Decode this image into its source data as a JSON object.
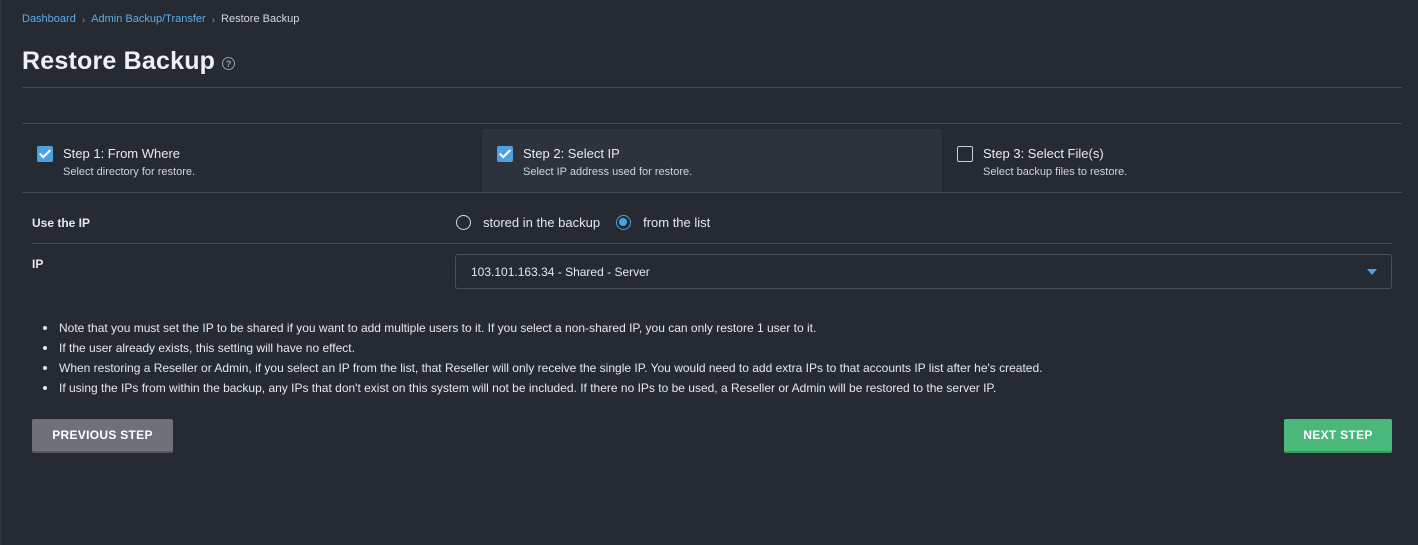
{
  "breadcrumb": {
    "items": [
      "Dashboard",
      "Admin Backup/Transfer"
    ],
    "current": "Restore Backup"
  },
  "page": {
    "title": "Restore Backup",
    "help_icon": "question-circle-icon"
  },
  "steps": [
    {
      "title": "Step 1: From Where",
      "subtitle": "Select directory for restore.",
      "checked": true,
      "active": false
    },
    {
      "title": "Step 2: Select IP",
      "subtitle": "Select IP address used for restore.",
      "checked": true,
      "active": true
    },
    {
      "title": "Step 3: Select File(s)",
      "subtitle": "Select backup files to restore.",
      "checked": false,
      "active": false
    }
  ],
  "form": {
    "use_ip_label": "Use the IP",
    "radio_options": [
      {
        "label": "stored in the backup",
        "selected": false
      },
      {
        "label": "from the list",
        "selected": true
      }
    ],
    "ip_label": "IP",
    "ip_select_value": "103.101.163.34 - Shared - Server"
  },
  "notes": [
    "Note that you must set the IP to be shared if you want to add multiple users to it. If you select a non-shared IP, you can only restore 1 user to it.",
    "If the user already exists, this setting will have no effect.",
    "When restoring a Reseller or Admin, if you select an IP from the list, that Reseller will only receive the single IP. You would need to add extra IPs to that accounts IP list after he's created.",
    "If using the IPs from within the backup, any IPs that don't exist on this system will not be included. If there no IPs to be used, a Reseller or Admin will be restored to the server IP."
  ],
  "buttons": {
    "previous": "PREVIOUS STEP",
    "next": "NEXT STEP"
  },
  "colors": {
    "background": "#262a33",
    "accent": "#4aa3e0",
    "link": "#5aaee8",
    "next_button": "#49b87a",
    "prev_button": "#6e7178"
  }
}
